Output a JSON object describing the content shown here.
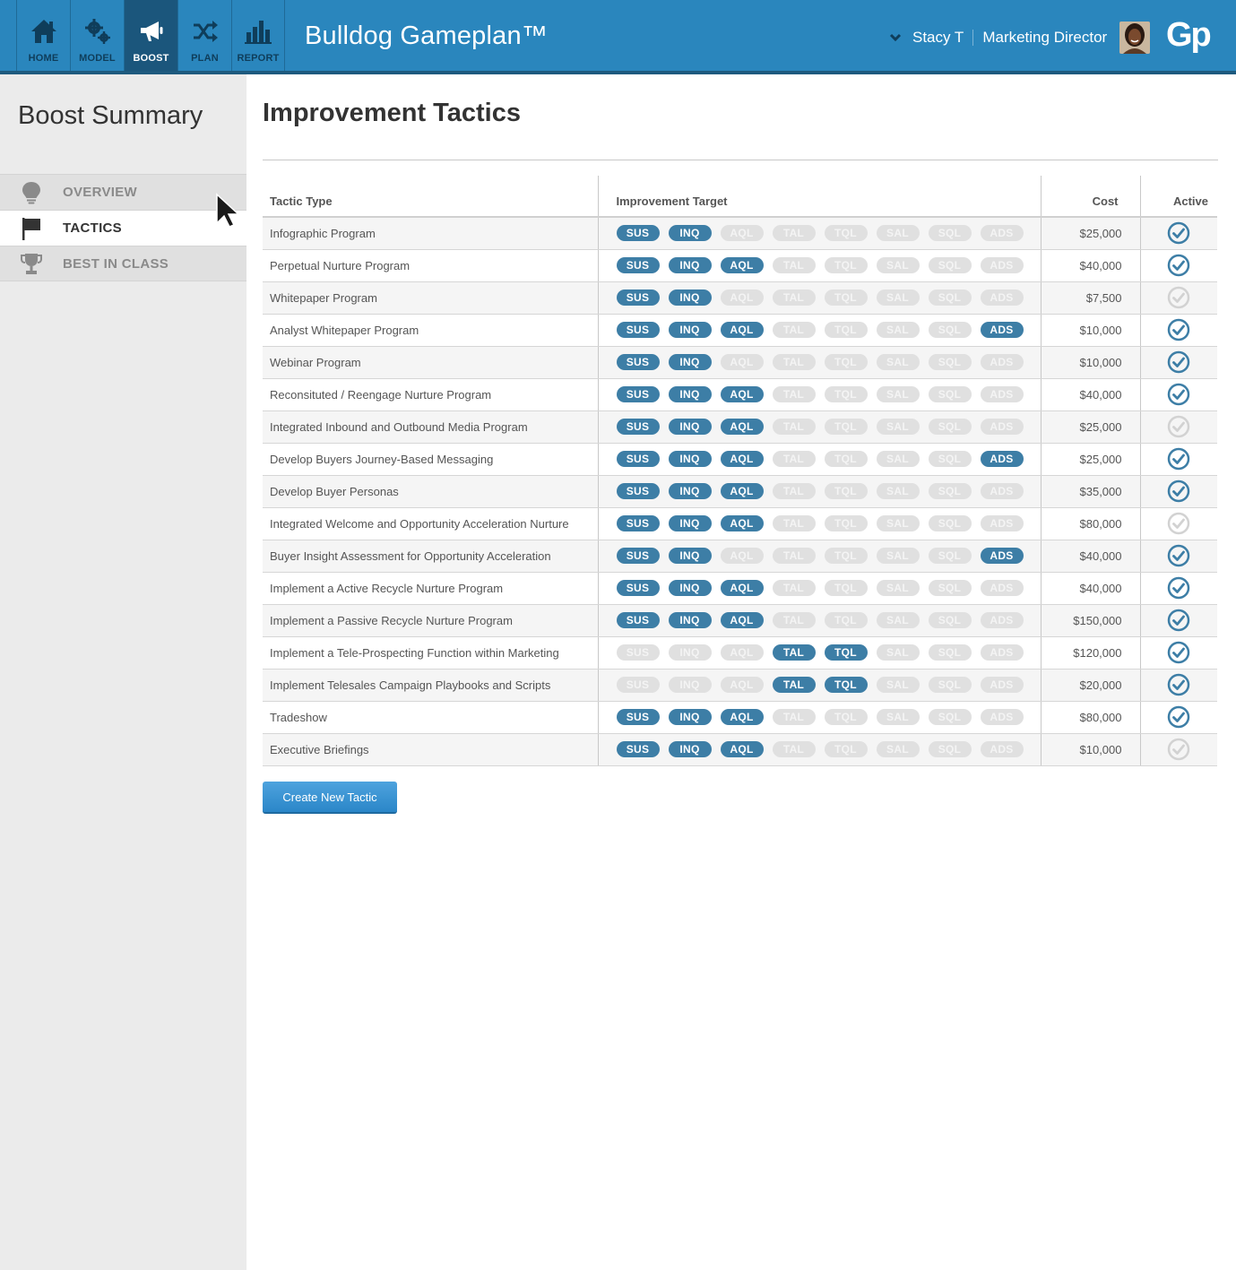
{
  "app": {
    "title": "Bulldog Gameplan™",
    "logo": "Gp",
    "accent_color": "#2a86bd",
    "nav": [
      {
        "label": "HOME",
        "icon": "home-icon",
        "active": false
      },
      {
        "label": "MODEL",
        "icon": "gears-icon",
        "active": false
      },
      {
        "label": "BOOST",
        "icon": "megaphone-icon",
        "active": true
      },
      {
        "label": "PLAN",
        "icon": "shuffle-icon",
        "active": false
      },
      {
        "label": "REPORT",
        "icon": "bar-chart-icon",
        "active": false
      }
    ]
  },
  "user": {
    "name": "Stacy T",
    "role": "Marketing Director"
  },
  "sidebar": {
    "title": "Boost Summary",
    "items": [
      {
        "label": "OVERVIEW",
        "icon": "lightbulb-icon",
        "active": false
      },
      {
        "label": "TACTICS",
        "icon": "flag-icon",
        "active": true
      },
      {
        "label": "BEST IN CLASS",
        "icon": "trophy-icon",
        "active": false
      }
    ]
  },
  "main": {
    "title": "Improvement Tactics",
    "columns": {
      "type": "Tactic Type",
      "target": "Improvement Target",
      "cost": "Cost",
      "active": "Active"
    },
    "target_labels": [
      "SUS",
      "INQ",
      "AQL",
      "TAL",
      "TQL",
      "SAL",
      "SQL",
      "ADS"
    ],
    "rows": [
      {
        "name": "Infographic Program",
        "targets": [
          "SUS",
          "INQ"
        ],
        "cost": "$25,000",
        "active": true
      },
      {
        "name": "Perpetual Nurture Program",
        "targets": [
          "SUS",
          "INQ",
          "AQL"
        ],
        "cost": "$40,000",
        "active": true
      },
      {
        "name": "Whitepaper Program",
        "targets": [
          "SUS",
          "INQ"
        ],
        "cost": "$7,500",
        "active": false
      },
      {
        "name": "Analyst Whitepaper Program",
        "targets": [
          "SUS",
          "INQ",
          "AQL",
          "ADS"
        ],
        "cost": "$10,000",
        "active": true
      },
      {
        "name": "Webinar Program",
        "targets": [
          "SUS",
          "INQ"
        ],
        "cost": "$10,000",
        "active": true
      },
      {
        "name": "Reconsituted / Reengage Nurture Program",
        "targets": [
          "SUS",
          "INQ",
          "AQL"
        ],
        "cost": "$40,000",
        "active": true
      },
      {
        "name": "Integrated Inbound and Outbound Media Program",
        "targets": [
          "SUS",
          "INQ",
          "AQL"
        ],
        "cost": "$25,000",
        "active": false
      },
      {
        "name": "Develop Buyers Journey-Based Messaging",
        "targets": [
          "SUS",
          "INQ",
          "AQL",
          "ADS"
        ],
        "cost": "$25,000",
        "active": true
      },
      {
        "name": "Develop Buyer Personas",
        "targets": [
          "SUS",
          "INQ",
          "AQL"
        ],
        "cost": "$35,000",
        "active": true
      },
      {
        "name": "Integrated Welcome and Opportunity Acceleration Nurture",
        "targets": [
          "SUS",
          "INQ",
          "AQL"
        ],
        "cost": "$80,000",
        "active": false
      },
      {
        "name": "Buyer Insight Assessment for Opportunity Acceleration",
        "targets": [
          "SUS",
          "INQ",
          "ADS"
        ],
        "cost": "$40,000",
        "active": true
      },
      {
        "name": "Implement a Active Recycle Nurture Program",
        "targets": [
          "SUS",
          "INQ",
          "AQL"
        ],
        "cost": "$40,000",
        "active": true
      },
      {
        "name": "Implement a Passive Recycle Nurture Program",
        "targets": [
          "SUS",
          "INQ",
          "AQL"
        ],
        "cost": "$150,000",
        "active": true
      },
      {
        "name": "Implement a Tele-Prospecting Function within Marketing",
        "targets": [
          "TAL",
          "TQL"
        ],
        "cost": "$120,000",
        "active": true
      },
      {
        "name": "Implement Telesales Campaign Playbooks and Scripts",
        "targets": [
          "TAL",
          "TQL"
        ],
        "cost": "$20,000",
        "active": true
      },
      {
        "name": "Tradeshow",
        "targets": [
          "SUS",
          "INQ",
          "AQL"
        ],
        "cost": "$80,000",
        "active": true
      },
      {
        "name": "Executive Briefings",
        "targets": [
          "SUS",
          "INQ",
          "AQL"
        ],
        "cost": "$10,000",
        "active": false
      }
    ],
    "create_button": "Create New Tactic"
  }
}
